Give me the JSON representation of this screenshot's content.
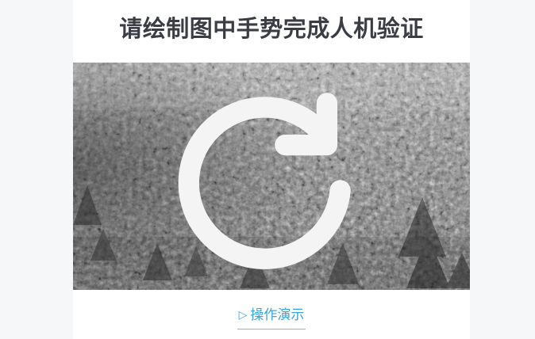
{
  "captcha": {
    "title": "请绘制图中手势完成人机验证",
    "image_icon": "refresh-icon",
    "demo_icon": "play-icon",
    "demo_label": "操作演示"
  }
}
